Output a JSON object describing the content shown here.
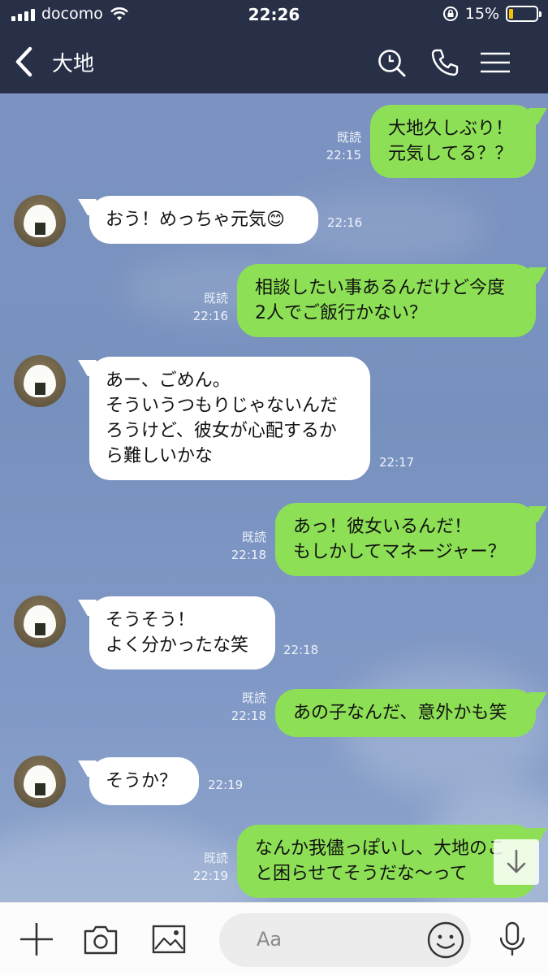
{
  "status_bar": {
    "carrier": "docomo",
    "time": "22:26",
    "battery": "15%"
  },
  "header": {
    "title": "大地"
  },
  "messages": [
    {
      "side": "me",
      "lines": [
        "大地久しぶり！",
        "元気してる？？"
      ],
      "read": "既読",
      "time": "22:15"
    },
    {
      "side": "them",
      "lines": [
        "おう！めっちゃ元気😊"
      ],
      "time": "22:16"
    },
    {
      "side": "me",
      "lines": [
        "相談したい事あるんだけど今度",
        "2人でご飯行かない？"
      ],
      "read": "既読",
      "time": "22:16"
    },
    {
      "side": "them",
      "lines": [
        "あー、ごめん。",
        "そういうつもりじゃないんだ",
        "ろうけど、彼女が心配するか",
        "ら難しいかな"
      ],
      "time": "22:17"
    },
    {
      "side": "me",
      "lines": [
        "あっ！彼女いるんだ！",
        "もしかしてマネージャー？"
      ],
      "read": "既読",
      "time": "22:18"
    },
    {
      "side": "them",
      "lines": [
        "そうそう！",
        "よく分かったな笑"
      ],
      "time": "22:18"
    },
    {
      "side": "me",
      "lines": [
        "あの子なんだ、意外かも笑"
      ],
      "read": "既読",
      "time": "22:18"
    },
    {
      "side": "them",
      "lines": [
        "そうか？"
      ],
      "time": "22:19"
    },
    {
      "side": "me",
      "lines": [
        "なんか我儘っぽいし、大地のこ",
        "と困らせてそうだな〜って"
      ],
      "read": "既読",
      "time": "22:19"
    }
  ],
  "input": {
    "placeholder": "Aa"
  },
  "icons": {
    "back": "chevron-left-icon",
    "search": "search-icon",
    "call": "phone-icon",
    "menu": "menu-icon",
    "plus": "plus-icon",
    "camera": "camera-icon",
    "image": "image-icon",
    "emoji": "emoji-icon",
    "mic": "microphone-icon",
    "scroll": "arrow-down-icon"
  },
  "colors": {
    "header_bg": "#283047",
    "my_bubble": "#8de055",
    "their_bubble": "#ffffff",
    "chat_bg": "#7a93c0"
  }
}
